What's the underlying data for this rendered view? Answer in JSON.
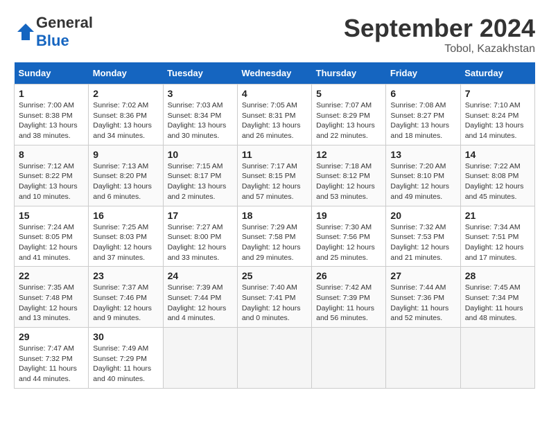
{
  "header": {
    "logo_general": "General",
    "logo_blue": "Blue",
    "month_title": "September 2024",
    "location": "Tobol, Kazakhstan"
  },
  "days_of_week": [
    "Sunday",
    "Monday",
    "Tuesday",
    "Wednesday",
    "Thursday",
    "Friday",
    "Saturday"
  ],
  "weeks": [
    [
      {
        "day": "1",
        "sunrise": "7:00 AM",
        "sunset": "8:38 PM",
        "daylight": "13 hours and 38 minutes."
      },
      {
        "day": "2",
        "sunrise": "7:02 AM",
        "sunset": "8:36 PM",
        "daylight": "13 hours and 34 minutes."
      },
      {
        "day": "3",
        "sunrise": "7:03 AM",
        "sunset": "8:34 PM",
        "daylight": "13 hours and 30 minutes."
      },
      {
        "day": "4",
        "sunrise": "7:05 AM",
        "sunset": "8:31 PM",
        "daylight": "13 hours and 26 minutes."
      },
      {
        "day": "5",
        "sunrise": "7:07 AM",
        "sunset": "8:29 PM",
        "daylight": "13 hours and 22 minutes."
      },
      {
        "day": "6",
        "sunrise": "7:08 AM",
        "sunset": "8:27 PM",
        "daylight": "13 hours and 18 minutes."
      },
      {
        "day": "7",
        "sunrise": "7:10 AM",
        "sunset": "8:24 PM",
        "daylight": "13 hours and 14 minutes."
      }
    ],
    [
      {
        "day": "8",
        "sunrise": "7:12 AM",
        "sunset": "8:22 PM",
        "daylight": "13 hours and 10 minutes."
      },
      {
        "day": "9",
        "sunrise": "7:13 AM",
        "sunset": "8:20 PM",
        "daylight": "13 hours and 6 minutes."
      },
      {
        "day": "10",
        "sunrise": "7:15 AM",
        "sunset": "8:17 PM",
        "daylight": "13 hours and 2 minutes."
      },
      {
        "day": "11",
        "sunrise": "7:17 AM",
        "sunset": "8:15 PM",
        "daylight": "12 hours and 57 minutes."
      },
      {
        "day": "12",
        "sunrise": "7:18 AM",
        "sunset": "8:12 PM",
        "daylight": "12 hours and 53 minutes."
      },
      {
        "day": "13",
        "sunrise": "7:20 AM",
        "sunset": "8:10 PM",
        "daylight": "12 hours and 49 minutes."
      },
      {
        "day": "14",
        "sunrise": "7:22 AM",
        "sunset": "8:08 PM",
        "daylight": "12 hours and 45 minutes."
      }
    ],
    [
      {
        "day": "15",
        "sunrise": "7:24 AM",
        "sunset": "8:05 PM",
        "daylight": "12 hours and 41 minutes."
      },
      {
        "day": "16",
        "sunrise": "7:25 AM",
        "sunset": "8:03 PM",
        "daylight": "12 hours and 37 minutes."
      },
      {
        "day": "17",
        "sunrise": "7:27 AM",
        "sunset": "8:00 PM",
        "daylight": "12 hours and 33 minutes."
      },
      {
        "day": "18",
        "sunrise": "7:29 AM",
        "sunset": "7:58 PM",
        "daylight": "12 hours and 29 minutes."
      },
      {
        "day": "19",
        "sunrise": "7:30 AM",
        "sunset": "7:56 PM",
        "daylight": "12 hours and 25 minutes."
      },
      {
        "day": "20",
        "sunrise": "7:32 AM",
        "sunset": "7:53 PM",
        "daylight": "12 hours and 21 minutes."
      },
      {
        "day": "21",
        "sunrise": "7:34 AM",
        "sunset": "7:51 PM",
        "daylight": "12 hours and 17 minutes."
      }
    ],
    [
      {
        "day": "22",
        "sunrise": "7:35 AM",
        "sunset": "7:48 PM",
        "daylight": "12 hours and 13 minutes."
      },
      {
        "day": "23",
        "sunrise": "7:37 AM",
        "sunset": "7:46 PM",
        "daylight": "12 hours and 9 minutes."
      },
      {
        "day": "24",
        "sunrise": "7:39 AM",
        "sunset": "7:44 PM",
        "daylight": "12 hours and 4 minutes."
      },
      {
        "day": "25",
        "sunrise": "7:40 AM",
        "sunset": "7:41 PM",
        "daylight": "12 hours and 0 minutes."
      },
      {
        "day": "26",
        "sunrise": "7:42 AM",
        "sunset": "7:39 PM",
        "daylight": "11 hours and 56 minutes."
      },
      {
        "day": "27",
        "sunrise": "7:44 AM",
        "sunset": "7:36 PM",
        "daylight": "11 hours and 52 minutes."
      },
      {
        "day": "28",
        "sunrise": "7:45 AM",
        "sunset": "7:34 PM",
        "daylight": "11 hours and 48 minutes."
      }
    ],
    [
      {
        "day": "29",
        "sunrise": "7:47 AM",
        "sunset": "7:32 PM",
        "daylight": "11 hours and 44 minutes."
      },
      {
        "day": "30",
        "sunrise": "7:49 AM",
        "sunset": "7:29 PM",
        "daylight": "11 hours and 40 minutes."
      },
      null,
      null,
      null,
      null,
      null
    ]
  ]
}
